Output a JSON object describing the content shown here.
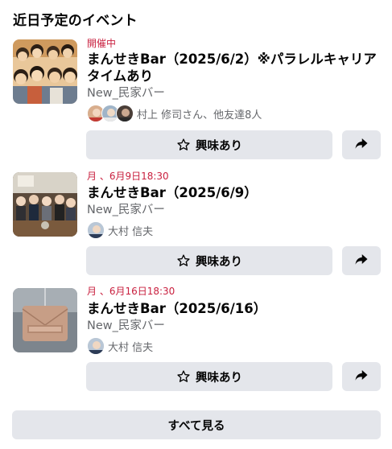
{
  "section": {
    "title": "近日予定のイベント"
  },
  "events": [
    {
      "date": "開催中",
      "name": "まんせきBar（2025/6/2）※パラレルキャリアタイムあり",
      "host": "New_民家バー",
      "people": "村上 修司さん、他友達8人",
      "interest_label": "興味あり"
    },
    {
      "date": "月 、6月9日18:30",
      "name": "まんせきBar（2025/6/9）",
      "host": "New_民家バー",
      "people": "大村 信夫",
      "interest_label": "興味あり"
    },
    {
      "date": "月 、6月16日18:30",
      "name": "まんせきBar（2025/6/16）",
      "host": "New_民家バー",
      "people": "大村 信夫",
      "interest_label": "興味あり"
    }
  ],
  "see_all_label": "すべて見る",
  "icons": {
    "interest": "star-outline-icon",
    "share": "share-arrow-icon"
  },
  "colors": {
    "date_text": "#c9203f",
    "button_bg": "#e4e6eb",
    "secondary_text": "#65676b"
  }
}
